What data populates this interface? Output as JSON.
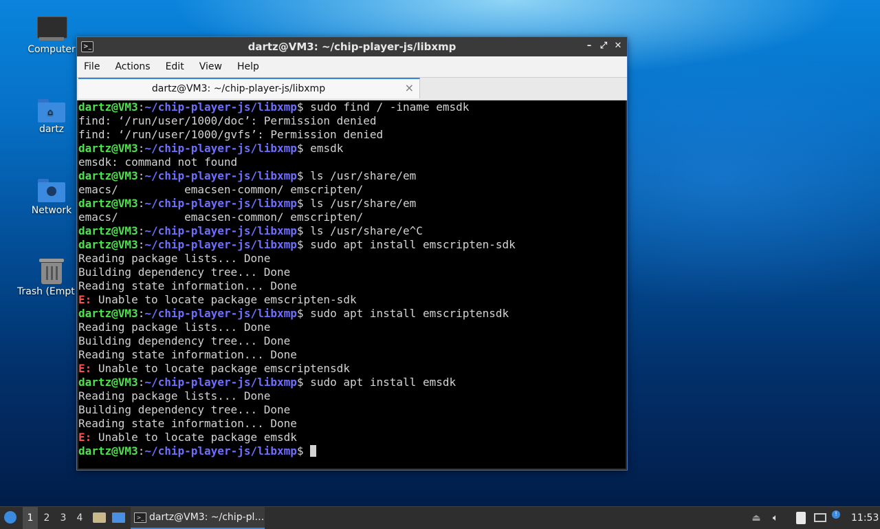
{
  "desktop": {
    "icons": [
      {
        "label": "Computer",
        "icon": "computer-icon"
      },
      {
        "label": "dartz",
        "icon": "home-folder-icon"
      },
      {
        "label": "Network",
        "icon": "network-folder-icon"
      },
      {
        "label": "Trash (Empty)",
        "icon": "trash-icon"
      }
    ]
  },
  "window": {
    "title": "dartz@VM3: ~/chip-player-js/libxmp",
    "menu": [
      "File",
      "Actions",
      "Edit",
      "View",
      "Help"
    ],
    "tab": {
      "label": "dartz@VM3: ~/chip-player-js/libxmp",
      "close": "×"
    },
    "prompt_user": "dartz@VM3",
    "prompt_path": "~/chip-player-js/libxmp",
    "terminal_lines": [
      {
        "type": "prompt",
        "cmd": " sudo find / -iname emsdk"
      },
      {
        "type": "out",
        "text": "find: ‘/run/user/1000/doc’: Permission denied"
      },
      {
        "type": "out",
        "text": "find: ‘/run/user/1000/gvfs’: Permission denied"
      },
      {
        "type": "prompt",
        "cmd": " emsdk"
      },
      {
        "type": "out",
        "text": "emsdk: command not found"
      },
      {
        "type": "prompt",
        "cmd": " ls /usr/share/em"
      },
      {
        "type": "out",
        "text": "emacs/          emacsen-common/ emscripten/"
      },
      {
        "type": "prompt",
        "cmd": " ls /usr/share/em"
      },
      {
        "type": "out",
        "text": "emacs/          emacsen-common/ emscripten/"
      },
      {
        "type": "prompt",
        "cmd": " ls /usr/share/e^C"
      },
      {
        "type": "prompt",
        "cmd": " sudo apt install emscripten-sdk"
      },
      {
        "type": "out",
        "text": "Reading package lists... Done"
      },
      {
        "type": "out",
        "text": "Building dependency tree... Done"
      },
      {
        "type": "out",
        "text": "Reading state information... Done"
      },
      {
        "type": "err",
        "tag": "E:",
        "text": " Unable to locate package emscripten-sdk"
      },
      {
        "type": "prompt",
        "cmd": " sudo apt install emscriptensdk"
      },
      {
        "type": "out",
        "text": "Reading package lists... Done"
      },
      {
        "type": "out",
        "text": "Building dependency tree... Done"
      },
      {
        "type": "out",
        "text": "Reading state information... Done"
      },
      {
        "type": "err",
        "tag": "E:",
        "text": " Unable to locate package emscriptensdk"
      },
      {
        "type": "prompt",
        "cmd": " sudo apt install emsdk"
      },
      {
        "type": "out",
        "text": "Reading package lists... Done"
      },
      {
        "type": "out",
        "text": "Building dependency tree... Done"
      },
      {
        "type": "out",
        "text": "Reading state information... Done"
      },
      {
        "type": "err",
        "tag": "E:",
        "text": " Unable to locate package emsdk"
      },
      {
        "type": "prompt",
        "cmd": " ",
        "cursor": true
      }
    ]
  },
  "taskbar": {
    "workspaces": [
      "1",
      "2",
      "3",
      "4"
    ],
    "active_workspace": "1",
    "task_label": "dartz@VM3: ~/chip-pl…",
    "clock": "11:53"
  },
  "colors": {
    "accent": "#3584e4",
    "prompt_user": "#4ee34e",
    "prompt_path": "#6f6fff",
    "error": "#ff4f4f"
  }
}
